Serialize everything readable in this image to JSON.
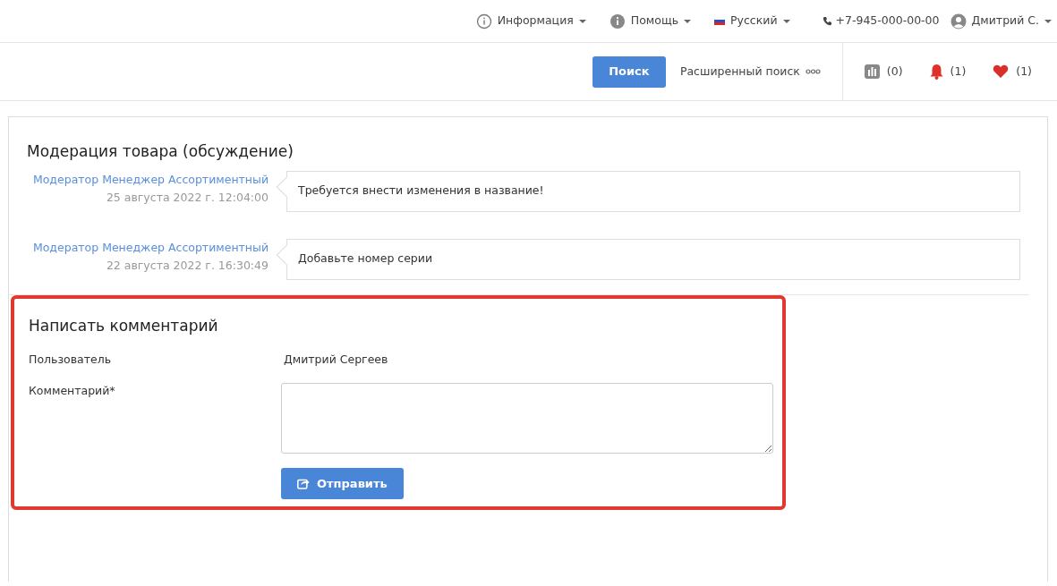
{
  "top_bar": {
    "items": [
      {
        "kind": "info",
        "label": "Информация"
      },
      {
        "kind": "help",
        "label": "Помощь"
      },
      {
        "kind": "language",
        "label": "Русский"
      },
      {
        "kind": "phone",
        "label": "+7-945-000-00-00"
      },
      {
        "kind": "user",
        "label": "Дмитрий С."
      }
    ]
  },
  "search_bar": {
    "search_button": "Поиск",
    "advanced_search": "Расширенный поиск",
    "counters": [
      {
        "kind": "compare",
        "count": "(0)"
      },
      {
        "kind": "notifications",
        "count": "(1)"
      },
      {
        "kind": "favorites",
        "count": "(1)"
      }
    ]
  },
  "discussion": {
    "title": "Модерация товара (обсуждение)",
    "messages": [
      {
        "author": "Модератор Менеджер Ассортиментный",
        "date": "25 августа 2022 г. 12:04:00",
        "text": "Требуется внести изменения в название!"
      },
      {
        "author": "Модератор Менеджер Ассортиментный",
        "date": "22 августа 2022 г. 16:30:49",
        "text": "Добавьте номер серии"
      }
    ]
  },
  "comment_form": {
    "title": "Написать комментарий",
    "user_label": "Пользователь",
    "user_value": "Дмитрий Сергеев",
    "comment_label": "Комментарий*",
    "submit": "Отправить"
  }
}
